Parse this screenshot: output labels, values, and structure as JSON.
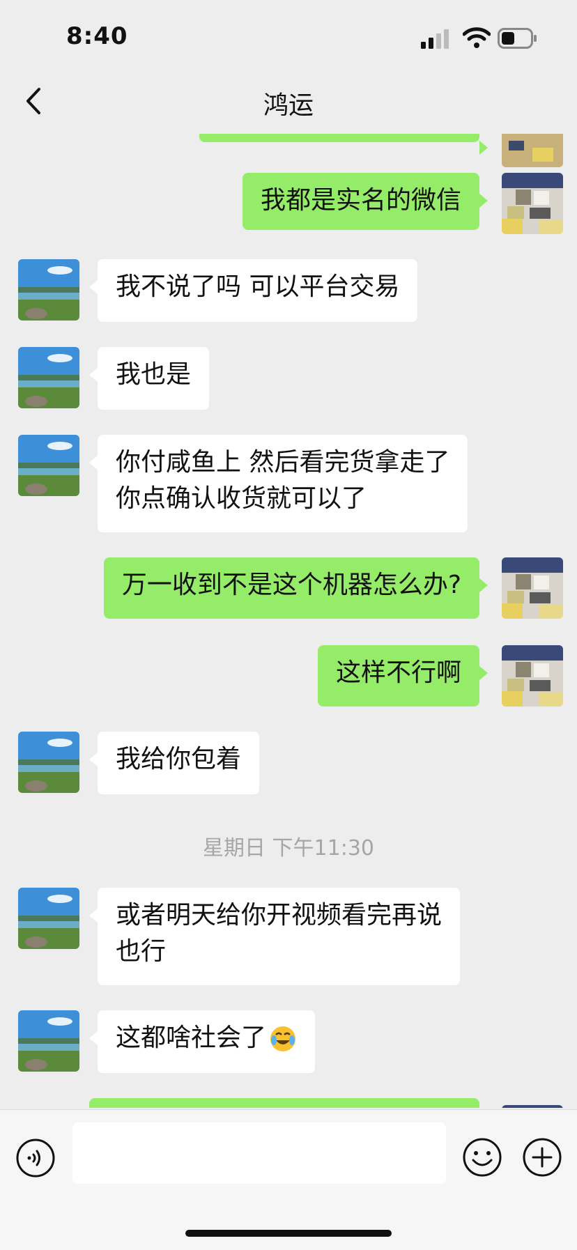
{
  "status": {
    "time": "8:40"
  },
  "nav": {
    "title": "鸿运"
  },
  "messages": [
    {
      "side": "out",
      "text": "我都是实名的微信"
    },
    {
      "side": "in",
      "text": "我不说了吗 可以平台交易"
    },
    {
      "side": "in",
      "text": "我也是"
    },
    {
      "side": "in",
      "text": "你付咸鱼上 然后看完货拿走了\n你点确认收货就可以了"
    },
    {
      "side": "out",
      "text": "万一收到不是这个机器怎么办?"
    },
    {
      "side": "out",
      "text": "这样不行啊"
    },
    {
      "side": "in",
      "text": "我给你包着"
    },
    {
      "side": "in",
      "text": "或者明天给你开视频看完再说\n也行"
    },
    {
      "side": "in",
      "text": "这都啥社会了",
      "emoji": "crying-laughing-emoji"
    }
  ],
  "timestamp": "星期日 下午11:30",
  "icons": {
    "back": "chevron-left-icon",
    "voice": "voice-input-icon",
    "emoji": "emoji-icon",
    "more": "plus-more-icon"
  },
  "colors": {
    "outgoing_bubble": "#95ec69",
    "incoming_bubble": "#ffffff",
    "background": "#ededed"
  }
}
